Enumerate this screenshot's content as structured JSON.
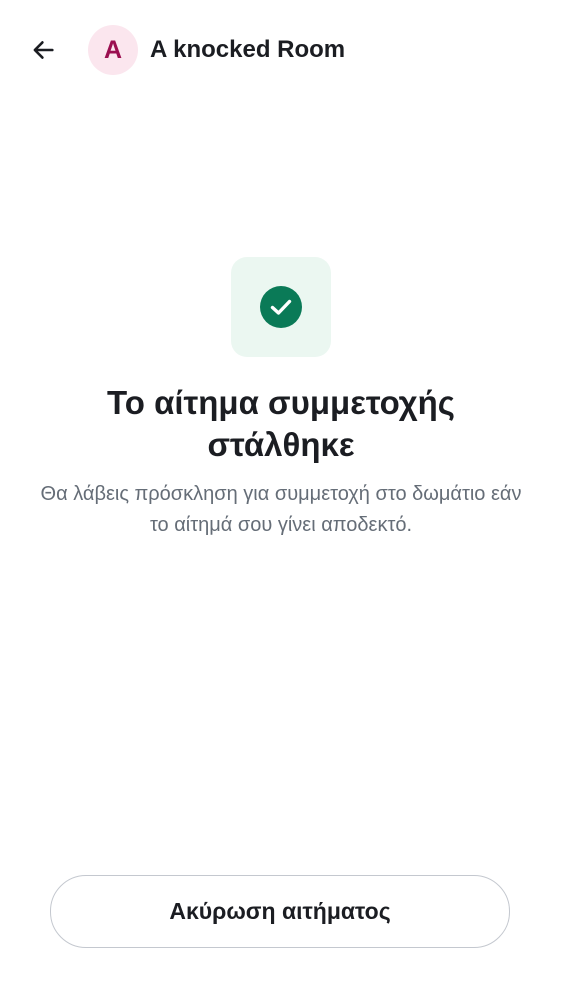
{
  "header": {
    "back_icon": "arrow-left-icon",
    "avatar_initial": "A",
    "avatar_bg": "#fbe6ee",
    "avatar_fg": "#9b0f50",
    "room_name": "A knocked Room"
  },
  "status": {
    "icon": "check-circle-icon",
    "icon_color": "#0a7a57",
    "tile_bg": "#ebf7f1",
    "title": "Το αίτημα συμμετοχής στάλθηκε",
    "message": "Θα λάβεις πρόσκληση για συμμετοχή στο δωμάτιο εάν το αίτημά σου γίνει αποδεκτό."
  },
  "actions": {
    "cancel_label": "Ακύρωση αιτήματος"
  }
}
